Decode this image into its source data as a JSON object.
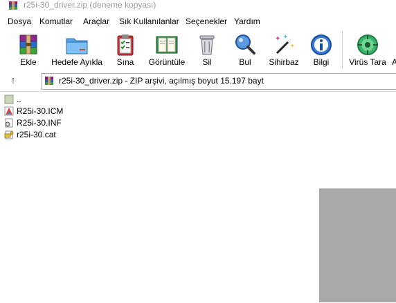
{
  "window": {
    "title": "r25i-30_driver.zip (deneme kopyası)"
  },
  "menu": [
    "Dosya",
    "Komutlar",
    "Araçlar",
    "Sık Kullanılanlar",
    "Seçenekler",
    "Yardım"
  ],
  "toolbar": {
    "buttons": [
      {
        "label": "Ekle",
        "icon": "add-archive-icon"
      },
      {
        "label": "Hedefe Ayıkla",
        "icon": "extract-folder-icon"
      },
      {
        "label": "Sına",
        "icon": "test-clipboard-icon"
      },
      {
        "label": "Görüntüle",
        "icon": "view-book-icon"
      },
      {
        "label": "Sil",
        "icon": "trash-icon"
      },
      {
        "label": "Bul",
        "icon": "magnifier-icon"
      },
      {
        "label": "Sihirbaz",
        "icon": "wizard-wand-icon"
      },
      {
        "label": "Bilgi",
        "icon": "info-icon"
      },
      {
        "label": "Virüs Tara",
        "icon": "virus-scan-icon"
      },
      {
        "label": "A",
        "icon": "comment-icon"
      }
    ]
  },
  "address": {
    "text": "r25i-30_driver.zip - ZIP arşivi, açılmış boyut 15.197 bayt"
  },
  "files": [
    {
      "name": "..",
      "icon": "parent-folder-icon"
    },
    {
      "name": "R25i-30.ICM",
      "icon": "color-profile-icon"
    },
    {
      "name": "R25i-30.INF",
      "icon": "setup-info-icon"
    },
    {
      "name": "r25i-30.cat",
      "icon": "catalog-icon"
    }
  ],
  "colors": {
    "title_text": "#9a9a9a",
    "overlay": "#a9a9a9",
    "virus_green": "#3cb371"
  }
}
